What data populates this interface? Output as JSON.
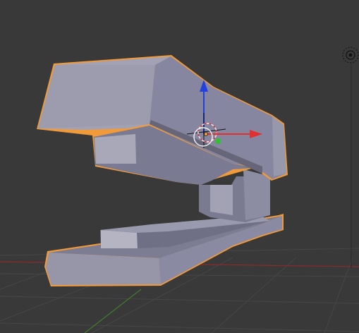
{
  "viewport": {
    "background": "#393939",
    "grid_line_color": "#464646",
    "x_axis_color": "#8a2b2b",
    "y_axis_color": "#3f7a2c",
    "object_fill_light": "#a2a2b4",
    "object_fill_mid": "#8c8ca2",
    "object_fill_dark": "#6f6f85",
    "selection_outline": "#f09a3a"
  },
  "object": {
    "name": "stapler",
    "selected": true
  },
  "gizmo": {
    "x_axis_color": "#e03030",
    "y_axis_color": "#30c030",
    "z_axis_color": "#2040e0"
  },
  "icons": {
    "viewport_grid": "grid-floor",
    "object_mesh": "stapler-mesh",
    "light": "light-icon",
    "origin": "origin-dot",
    "cursor": "3d-cursor-icon",
    "transform_gizmo": "translate-gizmo-icon"
  }
}
